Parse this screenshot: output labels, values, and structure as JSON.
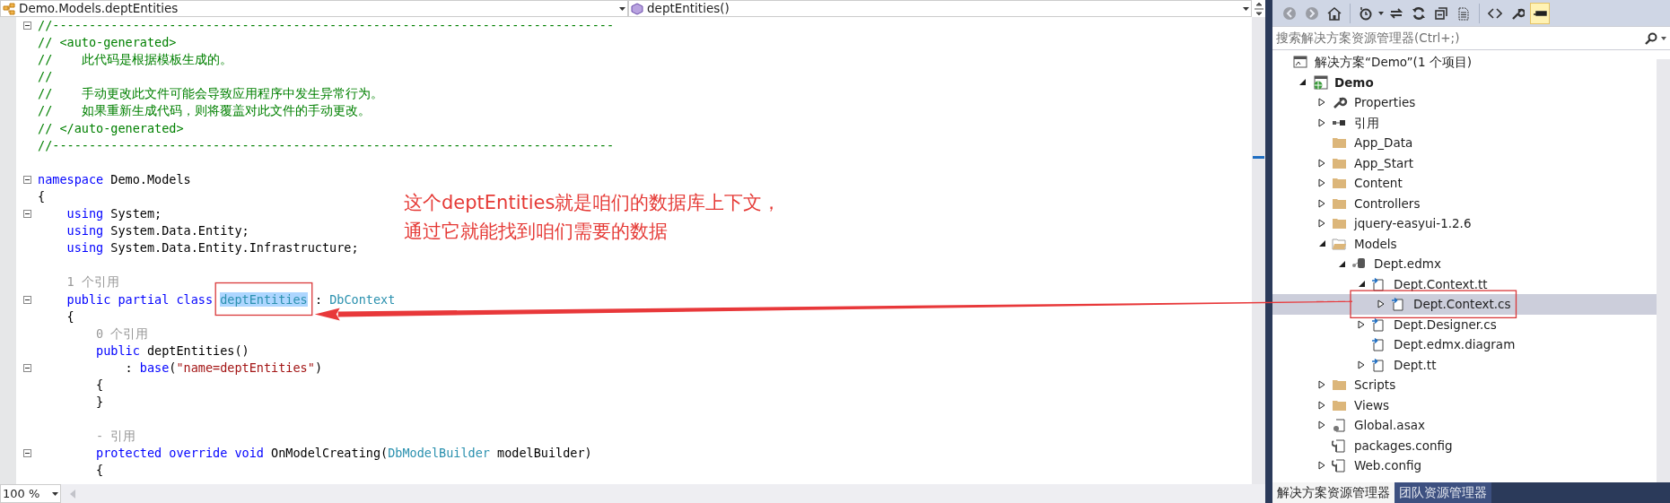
{
  "editor": {
    "type_dropdown": {
      "label": "Demo.Models.deptEntities"
    },
    "member_dropdown": {
      "label": "deptEntities()"
    },
    "lines": [
      {
        "foldable": true,
        "segments": [
          {
            "kind": "comment",
            "text": "//-----------------------------------------------------------------------------"
          }
        ]
      },
      {
        "foldable": false,
        "segments": [
          {
            "kind": "comment",
            "text": "// <auto-generated>"
          }
        ]
      },
      {
        "foldable": false,
        "segments": [
          {
            "kind": "comment",
            "text": "//    此代码是根据模板生成的。"
          }
        ]
      },
      {
        "foldable": false,
        "segments": [
          {
            "kind": "comment",
            "text": "//"
          }
        ]
      },
      {
        "foldable": false,
        "segments": [
          {
            "kind": "comment",
            "text": "//    手动更改此文件可能会导致应用程序中发生异常行为。"
          }
        ]
      },
      {
        "foldable": false,
        "segments": [
          {
            "kind": "comment",
            "text": "//    如果重新生成代码，则将覆盖对此文件的手动更改。"
          }
        ]
      },
      {
        "foldable": false,
        "segments": [
          {
            "kind": "comment",
            "text": "// </auto-generated>"
          }
        ]
      },
      {
        "foldable": false,
        "segments": [
          {
            "kind": "comment",
            "text": "//-----------------------------------------------------------------------------"
          }
        ]
      },
      {
        "foldable": false
      },
      {
        "foldable": true,
        "segments": [
          {
            "kind": "keyword",
            "text": "namespace"
          },
          {
            "kind": "plain",
            "text": " Demo.Models"
          }
        ]
      },
      {
        "foldable": false,
        "segments": [
          {
            "kind": "plain",
            "text": "{"
          }
        ]
      },
      {
        "foldable": true,
        "segments": [
          {
            "kind": "keyword",
            "text": "    using"
          },
          {
            "kind": "plain",
            "text": " System;"
          }
        ]
      },
      {
        "foldable": false,
        "segments": [
          {
            "kind": "keyword",
            "text": "    using"
          },
          {
            "kind": "plain",
            "text": " System.Data.Entity;"
          }
        ]
      },
      {
        "foldable": false,
        "segments": [
          {
            "kind": "keyword",
            "text": "    using"
          },
          {
            "kind": "plain",
            "text": " System.Data.Entity.Infrastructure;"
          }
        ]
      },
      {
        "foldable": false
      },
      {
        "foldable": false,
        "segments": [
          {
            "kind": "lens",
            "text": "    1 个引用"
          }
        ]
      },
      {
        "foldable": true,
        "segments": [
          {
            "kind": "keyword",
            "text": "    public partial class "
          },
          {
            "kind": "type",
            "text": "deptEntities",
            "highlighted": true
          },
          {
            "kind": "plain",
            "text": " : "
          },
          {
            "kind": "type",
            "text": "DbContext"
          }
        ]
      },
      {
        "foldable": false,
        "segments": [
          {
            "kind": "plain",
            "text": "    {"
          }
        ]
      },
      {
        "foldable": false,
        "segments": [
          {
            "kind": "lens",
            "text": "        0 个引用"
          }
        ]
      },
      {
        "foldable": false,
        "segments": [
          {
            "kind": "keyword",
            "text": "        public"
          },
          {
            "kind": "plain",
            "text": " deptEntities()"
          }
        ]
      },
      {
        "foldable": true,
        "segments": [
          {
            "kind": "plain",
            "text": "            : "
          },
          {
            "kind": "keyword",
            "text": "base"
          },
          {
            "kind": "plain",
            "text": "("
          },
          {
            "kind": "string",
            "text": "\"name=deptEntities\""
          },
          {
            "kind": "plain",
            "text": ")"
          }
        ]
      },
      {
        "foldable": false,
        "segments": [
          {
            "kind": "plain",
            "text": "        {"
          }
        ]
      },
      {
        "foldable": false,
        "segments": [
          {
            "kind": "plain",
            "text": "        }"
          }
        ]
      },
      {
        "foldable": false
      },
      {
        "foldable": false,
        "segments": [
          {
            "kind": "lens",
            "text": "        - 引用"
          }
        ]
      },
      {
        "foldable": true,
        "segments": [
          {
            "kind": "keyword",
            "text": "        protected override void"
          },
          {
            "kind": "plain",
            "text": " OnModelCreating("
          },
          {
            "kind": "type",
            "text": "DbModelBuilder"
          },
          {
            "kind": "plain",
            "text": " modelBuilder)"
          }
        ]
      },
      {
        "foldable": false,
        "segments": [
          {
            "kind": "plain",
            "text": "        {"
          }
        ]
      }
    ],
    "zoom": "100 %"
  },
  "annotation": {
    "lines": [
      "这个deptEntities就是咱们的数据库上下文，",
      "通过它就能找到咱们需要的数据"
    ]
  },
  "solution_explorer": {
    "toolbar": [
      {
        "kind": "back",
        "disabled": true,
        "on": false
      },
      {
        "kind": "forward",
        "disabled": true,
        "on": false
      },
      {
        "kind": "home",
        "disabled": false,
        "on": false
      },
      {
        "kind": "pending",
        "disabled": false,
        "on": false
      },
      {
        "kind": "sync",
        "disabled": false,
        "on": false
      },
      {
        "kind": "refresh",
        "disabled": false,
        "on": false
      },
      {
        "kind": "collapse",
        "disabled": false,
        "on": false
      },
      {
        "kind": "show-files",
        "disabled": false,
        "on": false
      },
      {
        "kind": "code",
        "disabled": false,
        "on": false
      },
      {
        "kind": "properties",
        "disabled": false,
        "on": false
      },
      {
        "kind": "preview",
        "disabled": false,
        "on": true
      }
    ],
    "search": {
      "placeholder": "搜索解决方案资源管理器(Ctrl+;)"
    },
    "tree": [
      {
        "label": "解决方案“Demo”(1 个项目)",
        "kind": "solution",
        "selected": false,
        "children": [
          {
            "label": "Demo",
            "kind": "project",
            "expanded": true,
            "selected": false,
            "children": [
              {
                "label": "Properties",
                "kind": "wrench",
                "expanded": false,
                "selected": false
              },
              {
                "label": "引用",
                "kind": "references",
                "expanded": false,
                "selected": false
              },
              {
                "label": "App_Data",
                "kind": "folder",
                "selected": false
              },
              {
                "label": "App_Start",
                "kind": "folder",
                "expanded": false,
                "selected": false
              },
              {
                "label": "Content",
                "kind": "folder",
                "expanded": false,
                "selected": false
              },
              {
                "label": "Controllers",
                "kind": "folder",
                "expanded": false,
                "selected": false
              },
              {
                "label": "jquery-easyui-1.2.6",
                "kind": "folder",
                "expanded": false,
                "selected": false
              },
              {
                "label": "Models",
                "kind": "folder-open",
                "expanded": true,
                "selected": false,
                "children": [
                  {
                    "label": "Dept.edmx",
                    "kind": "edmx",
                    "expanded": true,
                    "selected": false,
                    "children": [
                      {
                        "label": "Dept.Context.tt",
                        "kind": "file",
                        "expanded": true,
                        "selected": false,
                        "children": [
                          {
                            "label": "Dept.Context.cs",
                            "kind": "file",
                            "expanded": false,
                            "selected": true
                          }
                        ]
                      },
                      {
                        "label": "Dept.Designer.cs",
                        "kind": "file",
                        "expanded": false,
                        "selected": false
                      },
                      {
                        "label": "Dept.edmx.diagram",
                        "kind": "file",
                        "selected": false
                      },
                      {
                        "label": "Dept.tt",
                        "kind": "file",
                        "expanded": false,
                        "selected": false
                      }
                    ]
                  }
                ]
              },
              {
                "label": "Scripts",
                "kind": "folder",
                "expanded": false,
                "selected": false
              },
              {
                "label": "Views",
                "kind": "folder",
                "expanded": false,
                "selected": false
              },
              {
                "label": "Global.asax",
                "kind": "asax",
                "expanded": false,
                "selected": false
              },
              {
                "label": "packages.config",
                "kind": "config",
                "selected": false
              },
              {
                "label": "Web.config",
                "kind": "config",
                "expanded": false,
                "selected": false
              }
            ]
          }
        ]
      }
    ],
    "tabs": [
      {
        "label": "解决方案资源管理器",
        "selected": true
      },
      {
        "label": "团队资源管理器",
        "selected": false
      }
    ]
  }
}
